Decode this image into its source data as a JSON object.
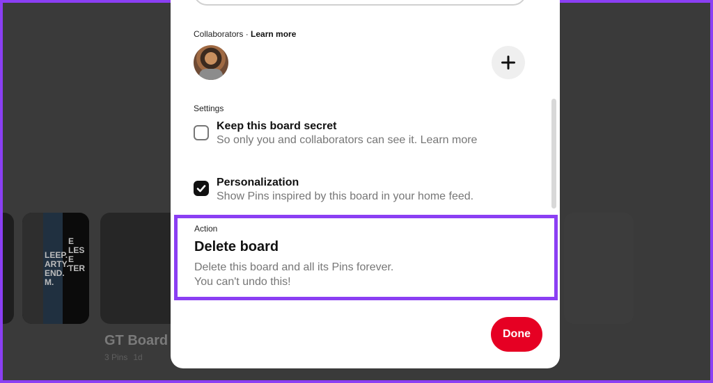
{
  "background": {
    "board": {
      "title": "GT Board",
      "pins": "3 Pins",
      "age": "1d"
    },
    "poster_text": [
      "LEEP.",
      "ARTY.",
      "END.",
      "M."
    ],
    "poster_text_2": [
      "E",
      "LES",
      "E",
      "TER"
    ]
  },
  "modal": {
    "collaborators": {
      "label": "Collaborators · ",
      "learn_more": "Learn more",
      "add_icon": "plus-icon"
    },
    "settings": {
      "label": "Settings",
      "secret": {
        "title": "Keep this board secret",
        "description": "So only you and collaborators can see it. Learn more",
        "checked": false
      },
      "personalization": {
        "title": "Personalization",
        "description": "Show Pins inspired by this board in your home feed.",
        "checked": true
      }
    },
    "action": {
      "label": "Action",
      "title": "Delete board",
      "description_line1": "Delete this board and all its Pins forever.",
      "description_line2": "You can't undo this!"
    },
    "done_label": "Done"
  },
  "colors": {
    "highlight": "#8b3ff3",
    "primary_button": "#e60023",
    "backdrop": "#3a3a3a"
  }
}
